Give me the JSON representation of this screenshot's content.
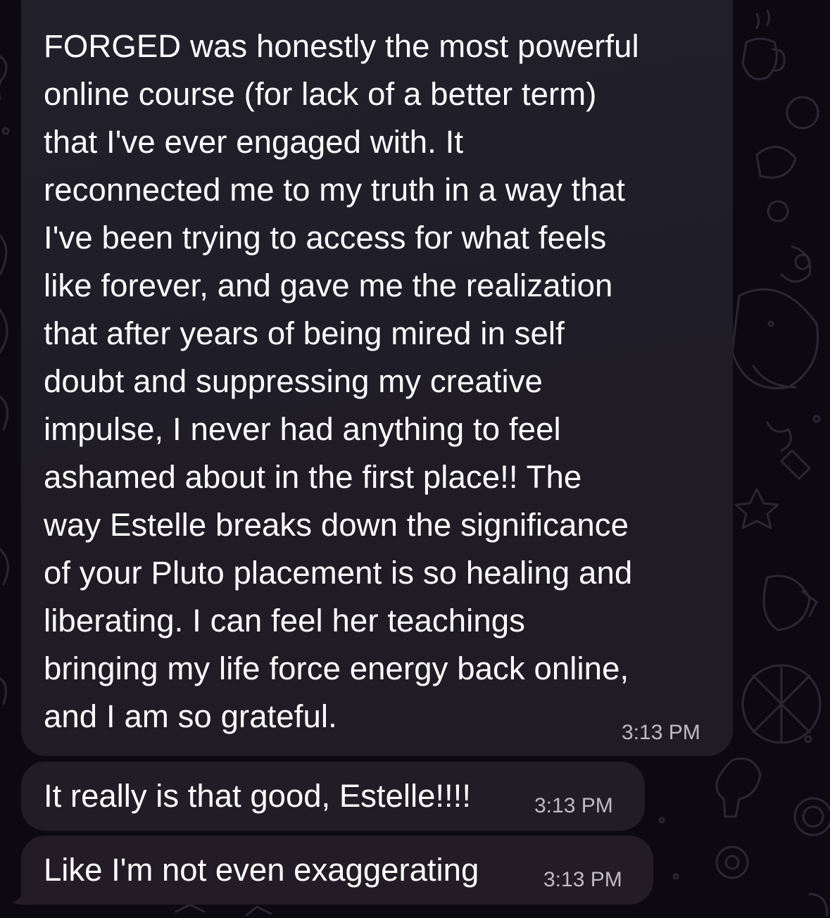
{
  "conversation": {
    "colors": {
      "background": "#0c0a10",
      "bubble": "#221e29",
      "text": "#ffffff",
      "timestamp": "#bdb9c4",
      "wallpaper_doodle": "#2a2530"
    },
    "messages": [
      {
        "text": "FORGED was honestly the most powerful\nonline course (for lack of a better term)\nthat I've ever engaged with. It\nreconnected me to my truth in a way that\nI've been trying to access for what feels\nlike forever, and gave me the realization\nthat after years of being mired in self\ndoubt and suppressing my creative\nimpulse, I never had anything to feel\nashamed about in the first place!! The\nway Estelle breaks down the significance\nof your Pluto placement is so healing and\nliberating. I can feel her teachings\nbringing my life force energy back online,\nand I am so grateful.",
        "time": "3:13 PM"
      },
      {
        "text": "It really is that good, Estelle!!!!",
        "time": "3:13 PM"
      },
      {
        "text": "Like I'm not even exaggerating",
        "time": "3:13 PM"
      }
    ]
  }
}
